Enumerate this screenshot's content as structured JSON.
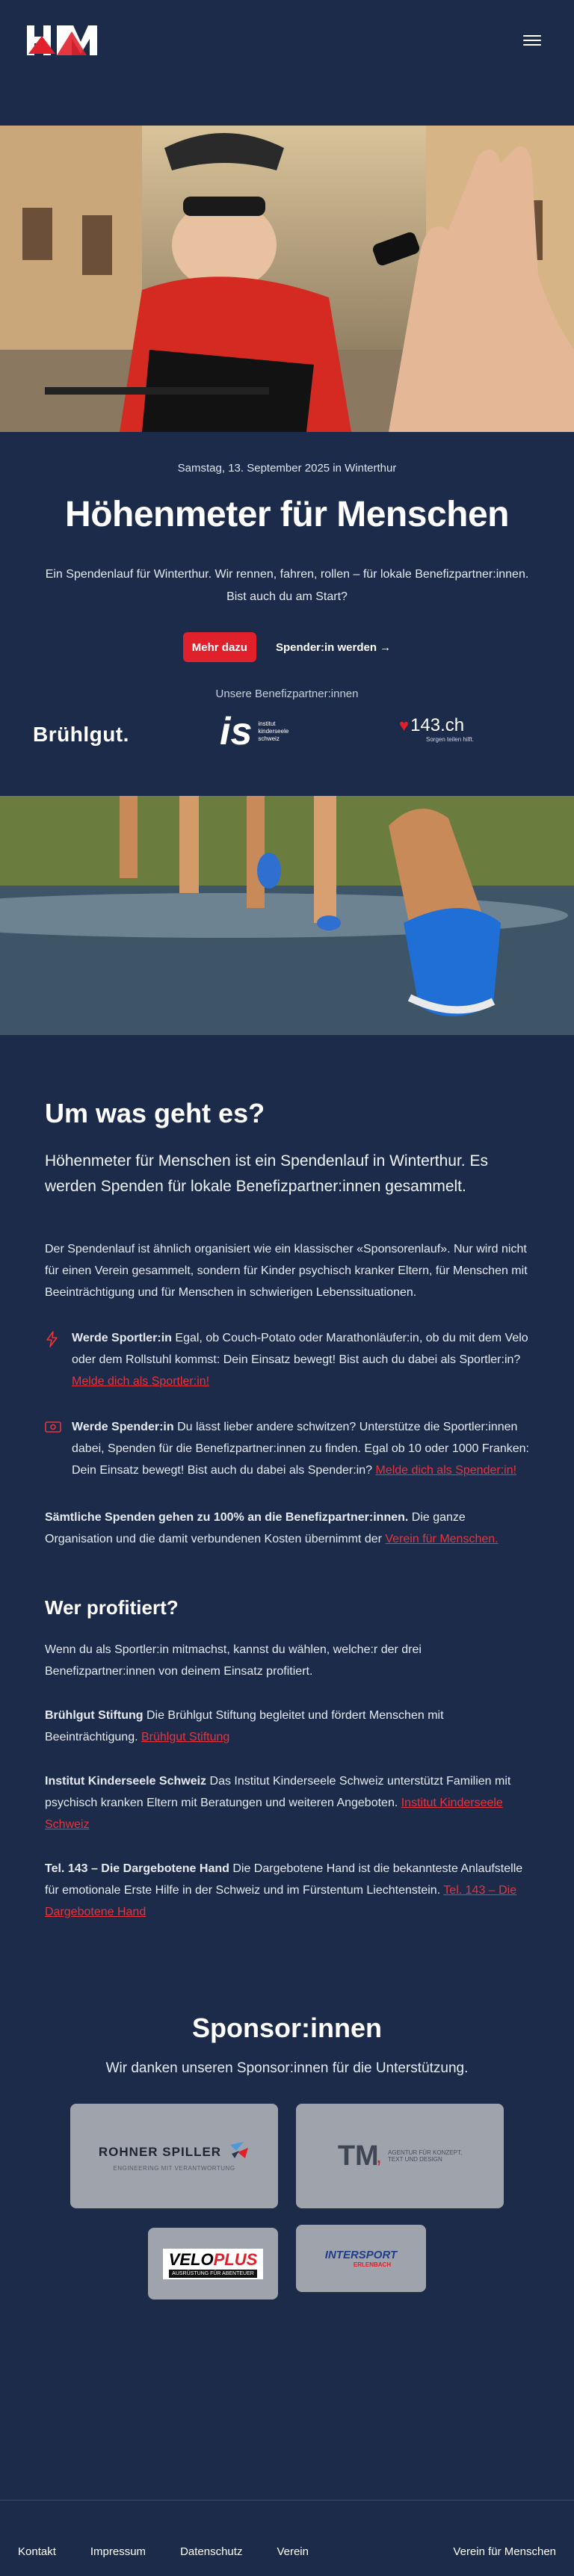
{
  "header": {
    "logo_text": "HfM",
    "menu_icon": "hamburger-icon"
  },
  "hero": {
    "date": "Samstag, 13. September 2025 in Winterthur",
    "title": "Höhenmeter für Menschen",
    "intro": "Ein Spendenlauf für Winterthur. Wir rennen, fahren, rollen – für lokale Benefizpartner:innen. Bist auch du am Start?",
    "primary_button": "Mehr dazu",
    "secondary_link": "Spender:in werden →",
    "partners_heading": "Unsere Benefizpartner:innen",
    "partner_logos": {
      "bruehlgut": "Brühlgut.",
      "kinderseele_mark": "is",
      "kinderseele_text_1": "institut",
      "kinderseele_text_2": "kinderseele",
      "kinderseele_text_3": "schweiz",
      "tel143": "143.ch",
      "tel143_sub": "Sorgen teilen hilft."
    }
  },
  "about": {
    "title": "Um was geht es?",
    "lead": "Höhenmeter für Menschen ist ein Spendenlauf in Winterthur. Es werden Spenden für lokale Benefizpartner:innen gesammelt.",
    "paragraph": "Der Spendenlauf ist ähnlich organisiert wie ein klassischer «Sponsorenlauf». Nur wird nicht für einen Verein gesammelt, sondern für Kinder psychisch kranker Eltern, für Menschen mit Beeinträchtigung und für Menschen in schwierigen Lebenssituationen.",
    "sportler": {
      "bold": "Werde Sportler:in",
      "text": " Egal, ob Couch-Potato oder Marathonläufer:in, ob du mit dem Velo oder dem Rollstuhl kommst: Dein Einsatz bewegt! Bist auch du dabei als Sportler:in? ",
      "link": "Melde dich als Sportler:in!"
    },
    "spender": {
      "bold": "Werde Spender:in",
      "text": " Du lässt lieber andere schwitzen? Unterstütze die Sportler:innen dabei, Spenden für die Benefizpartner:innen zu finden. Egal ob 10 oder 1000 Franken: Dein Einsatz bewegt! Bist auch du dabei als Spender:in? ",
      "link": "Melde dich als Spender:in!"
    },
    "spenden": {
      "bold": "Sämtliche Spenden gehen zu 100% an die Benefizpartner:innen.",
      "text": " Die ganze Organisation und die damit verbundenen Kosten übernimmt der ",
      "link": "Verein für Menschen."
    },
    "profit_title": "Wer profitiert?",
    "profit_intro": "Wenn du als Sportler:in mitmachst, kannst du wählen, welche:r der drei Benefizpartner:innen von deinem Einsatz profitiert.",
    "bruehlgut": {
      "bold": "Brühlgut Stiftung",
      "text": " Die Brühlgut Stiftung begleitet und fördert Menschen mit Beeinträchtigung. ",
      "link": "Brühlgut Stiftung"
    },
    "kinderseele": {
      "bold": "Institut Kinderseele Schweiz",
      "text": " Das Institut Kinderseele Schweiz unterstützt Familien mit psychisch kranken Eltern mit Beratungen und weiteren Angeboten. ",
      "link": "Institut Kinderseele Schweiz"
    },
    "tel143": {
      "bold": "Tel. 143 – Die Dargebotene Hand",
      "text": " Die Dargebotene Hand ist die bekannteste Anlaufstelle für emotionale Erste Hilfe in der Schweiz und im Fürstentum Liechtenstein. ",
      "link": "Tel. 143 – Die Dargebotene Hand"
    }
  },
  "sponsors": {
    "title": "Sponsor:innen",
    "subtitle": "Wir danken unseren Sponsor:innen für die Unterstützung.",
    "rohner": "ROHNER SPILLER",
    "rohner_sub": "ENGINEERING MIT VERANTWORTUNG",
    "tm": "TM",
    "tm_sub_1": "AGENTUR FÜR KONZEPT,",
    "tm_sub_2": "TEXT UND DESIGN",
    "veloplus_1": "VELO",
    "veloplus_2": "PLUS",
    "veloplus_sub": "AUSRÜSTUNG FÜR ABENTEUER",
    "intersport": "INTERSPORT",
    "intersport_sub": "ERLENBACH"
  },
  "footer": {
    "links": [
      "Kontakt",
      "Impressum",
      "Datenschutz",
      "Verein"
    ],
    "right": "Verein für Menschen"
  },
  "colors": {
    "background": "#1c2b4a",
    "accent": "#e0212c",
    "link": "#e8343c",
    "sponsor_card": "#9ea3ac"
  }
}
